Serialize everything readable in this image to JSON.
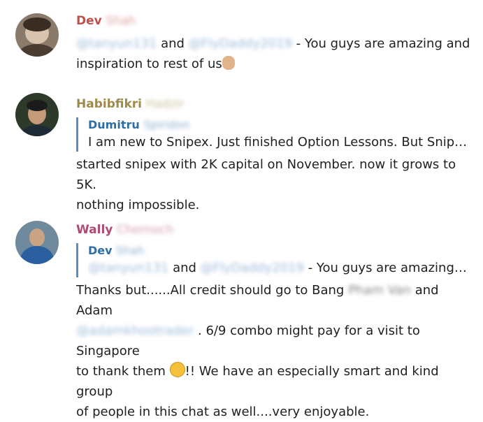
{
  "messages": [
    {
      "sender_first": "Dev",
      "sender_last": "Shah",
      "sender_color": "#c0504d",
      "line1_mention1": "@tanyun131",
      "line1_and": "and",
      "line1_mention2": "@FlyDaddy2019",
      "line1_rest": "- You guys are amazing and",
      "line2": "inspiration to rest of us",
      "emoji": "ok-hand-icon"
    },
    {
      "sender_first": "Habibfikri",
      "sender_last": "Hadzir",
      "sender_color": "#a08a4a",
      "quote_name": "Dumitru",
      "quote_name_extra": "Spiridon",
      "quote_text": "I am new to Snipex. Just finished Option Lessons. But Snipex …",
      "line1": "started snipex with 2K capital on November. now it grows to 5K.",
      "line2": "nothing impossible."
    },
    {
      "sender_first": "Wally",
      "sender_last": "Chernoch",
      "sender_color": "#b04a72",
      "quote_name": "Dev",
      "quote_name_extra": "Shah",
      "quote_mention1": "@tanyun131",
      "quote_and": "and",
      "quote_mention2": "@FlyDaddy2019",
      "quote_rest": "- You guys are amazing an…",
      "line1_a": "Thanks but......All credit should go to Bang",
      "line1_blur": "Pham Van",
      "line1_b": "and Adam",
      "line2_blur": "@adamkhootrader",
      "line2_b": ". 6/9 combo might pay for a visit to Singapore",
      "line3_a": "to thank them",
      "line3_b": "!! We have an especially smart and kind group",
      "line4": "of people in this chat as well....very enjoyable.",
      "emoji": "laughing-face-icon"
    }
  ]
}
